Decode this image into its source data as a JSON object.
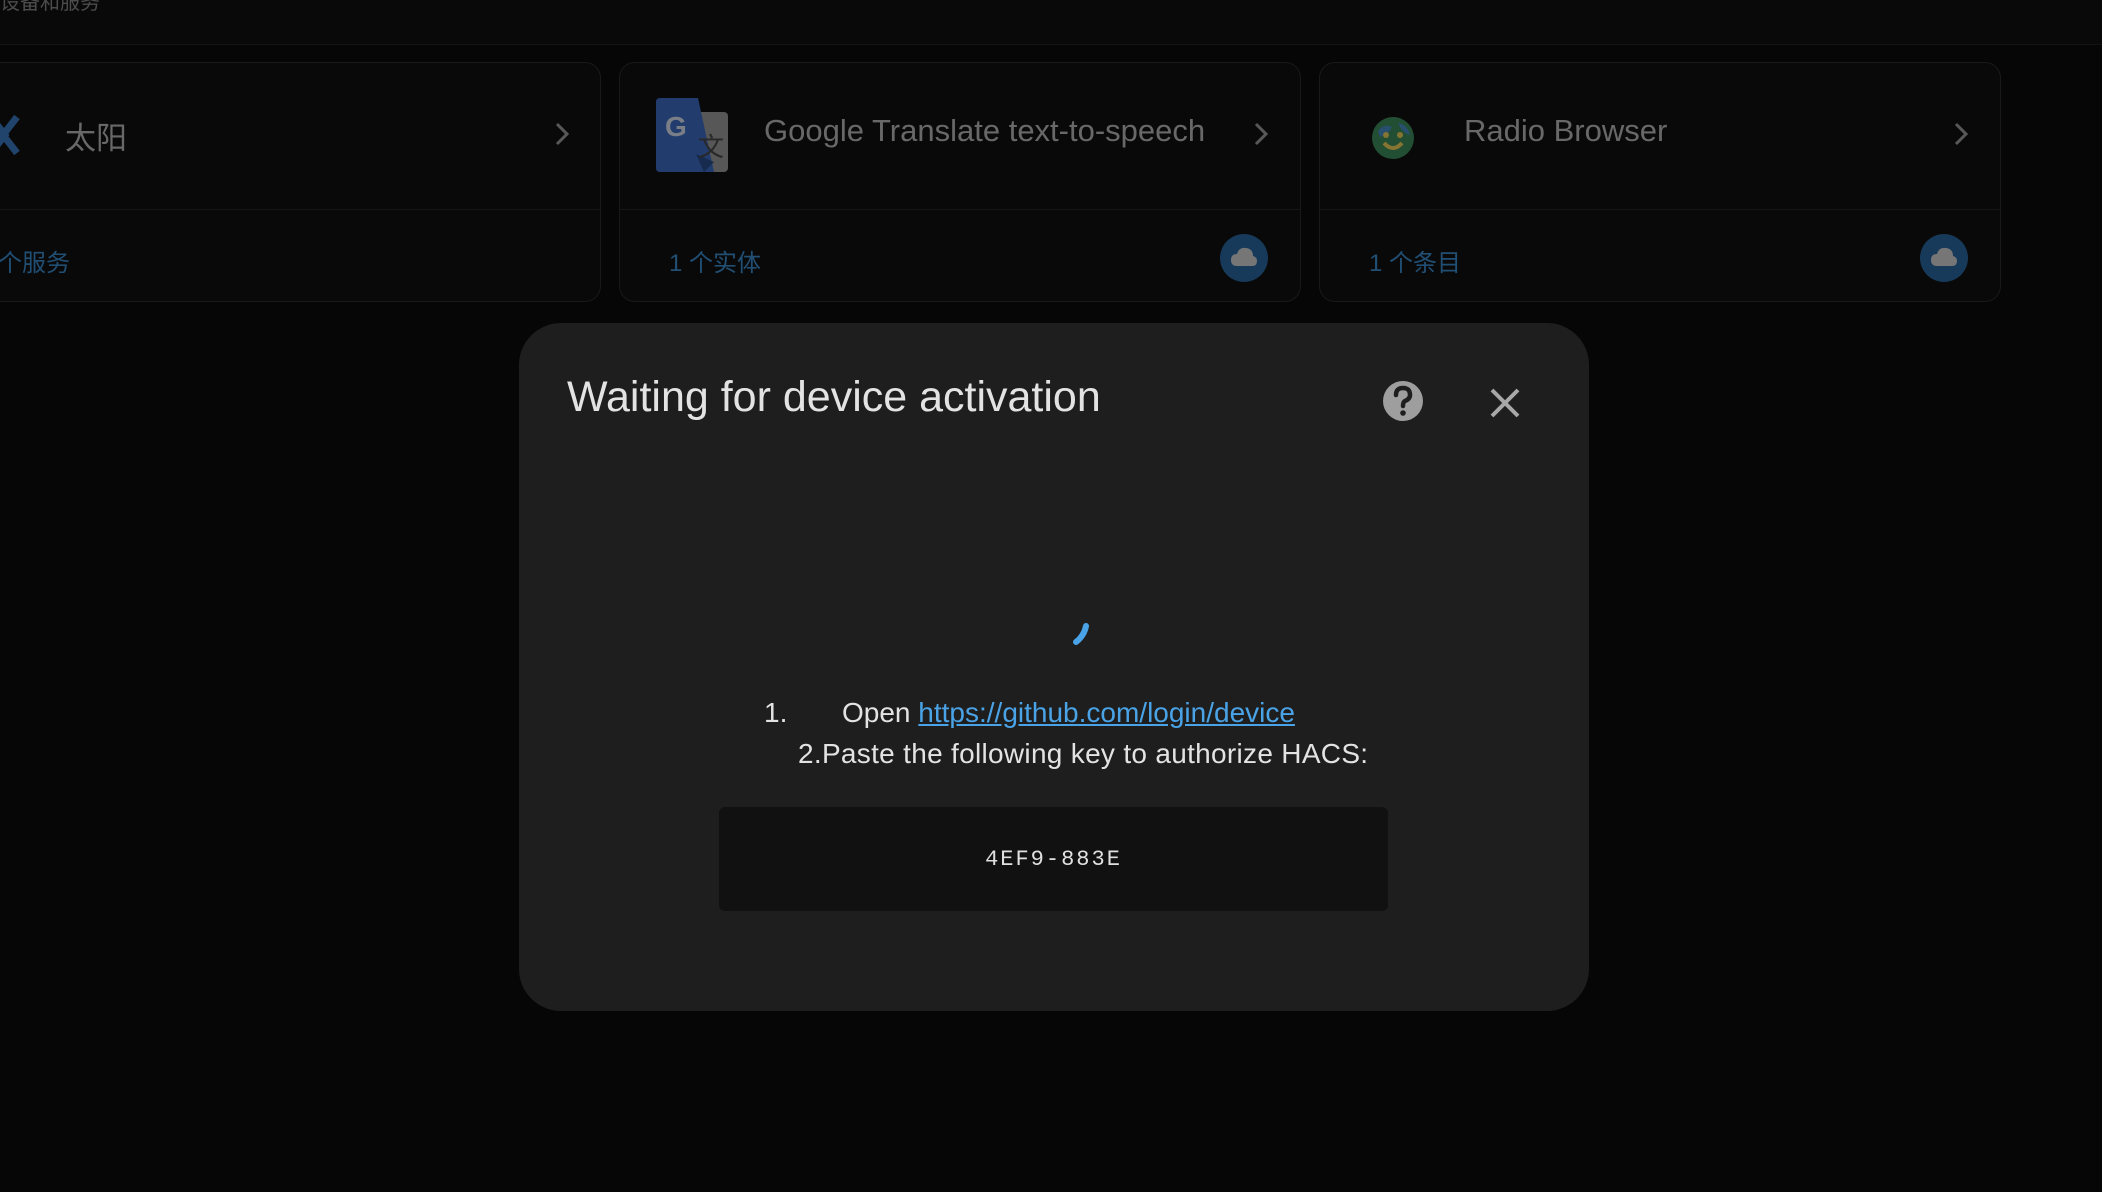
{
  "topbar": {
    "partial_title": "设备和服务"
  },
  "cards": [
    {
      "title": "太阳",
      "icon": "sun-brand-icon",
      "footer_link": "个服务",
      "has_cloud": false
    },
    {
      "title": "Google Translate text-to-speech",
      "icon": "google-translate-icon",
      "footer_link": "1 个实体",
      "has_cloud": true
    },
    {
      "title": "Radio Browser",
      "icon": "radio-browser-icon",
      "footer_link": "1 个条目",
      "has_cloud": true
    }
  ],
  "dialog": {
    "title": "Waiting for device activation",
    "step1_number": "1.",
    "step1_text": "Open ",
    "step1_link": "https://github.com/login/device",
    "step2_text": "2.Paste the following key to authorize HACS:",
    "device_code": "4EF9-883E",
    "help_icon": "help-circle-icon",
    "close_icon": "close-icon"
  },
  "colors": {
    "accent": "#4aa3e6",
    "link_blue": "#3d8fd1",
    "cloud_badge": "#2b6aa6",
    "dialog_bg": "#1e1e1e",
    "code_bg": "#111111"
  }
}
